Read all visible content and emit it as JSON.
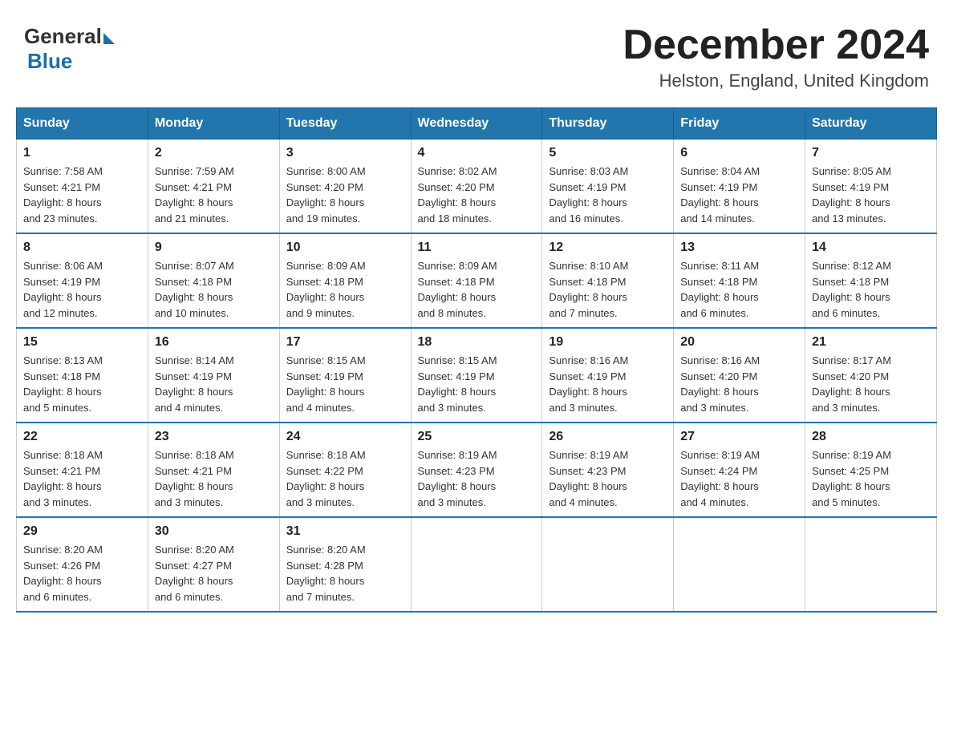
{
  "header": {
    "logo_general": "General",
    "logo_blue": "Blue",
    "month_title": "December 2024",
    "location": "Helston, England, United Kingdom"
  },
  "days_of_week": [
    "Sunday",
    "Monday",
    "Tuesday",
    "Wednesday",
    "Thursday",
    "Friday",
    "Saturday"
  ],
  "weeks": [
    [
      {
        "day": "1",
        "sunrise": "7:58 AM",
        "sunset": "4:21 PM",
        "daylight": "8 hours and 23 minutes."
      },
      {
        "day": "2",
        "sunrise": "7:59 AM",
        "sunset": "4:21 PM",
        "daylight": "8 hours and 21 minutes."
      },
      {
        "day": "3",
        "sunrise": "8:00 AM",
        "sunset": "4:20 PM",
        "daylight": "8 hours and 19 minutes."
      },
      {
        "day": "4",
        "sunrise": "8:02 AM",
        "sunset": "4:20 PM",
        "daylight": "8 hours and 18 minutes."
      },
      {
        "day": "5",
        "sunrise": "8:03 AM",
        "sunset": "4:19 PM",
        "daylight": "8 hours and 16 minutes."
      },
      {
        "day": "6",
        "sunrise": "8:04 AM",
        "sunset": "4:19 PM",
        "daylight": "8 hours and 14 minutes."
      },
      {
        "day": "7",
        "sunrise": "8:05 AM",
        "sunset": "4:19 PM",
        "daylight": "8 hours and 13 minutes."
      }
    ],
    [
      {
        "day": "8",
        "sunrise": "8:06 AM",
        "sunset": "4:19 PM",
        "daylight": "8 hours and 12 minutes."
      },
      {
        "day": "9",
        "sunrise": "8:07 AM",
        "sunset": "4:18 PM",
        "daylight": "8 hours and 10 minutes."
      },
      {
        "day": "10",
        "sunrise": "8:09 AM",
        "sunset": "4:18 PM",
        "daylight": "8 hours and 9 minutes."
      },
      {
        "day": "11",
        "sunrise": "8:09 AM",
        "sunset": "4:18 PM",
        "daylight": "8 hours and 8 minutes."
      },
      {
        "day": "12",
        "sunrise": "8:10 AM",
        "sunset": "4:18 PM",
        "daylight": "8 hours and 7 minutes."
      },
      {
        "day": "13",
        "sunrise": "8:11 AM",
        "sunset": "4:18 PM",
        "daylight": "8 hours and 6 minutes."
      },
      {
        "day": "14",
        "sunrise": "8:12 AM",
        "sunset": "4:18 PM",
        "daylight": "8 hours and 6 minutes."
      }
    ],
    [
      {
        "day": "15",
        "sunrise": "8:13 AM",
        "sunset": "4:18 PM",
        "daylight": "8 hours and 5 minutes."
      },
      {
        "day": "16",
        "sunrise": "8:14 AM",
        "sunset": "4:19 PM",
        "daylight": "8 hours and 4 minutes."
      },
      {
        "day": "17",
        "sunrise": "8:15 AM",
        "sunset": "4:19 PM",
        "daylight": "8 hours and 4 minutes."
      },
      {
        "day": "18",
        "sunrise": "8:15 AM",
        "sunset": "4:19 PM",
        "daylight": "8 hours and 3 minutes."
      },
      {
        "day": "19",
        "sunrise": "8:16 AM",
        "sunset": "4:19 PM",
        "daylight": "8 hours and 3 minutes."
      },
      {
        "day": "20",
        "sunrise": "8:16 AM",
        "sunset": "4:20 PM",
        "daylight": "8 hours and 3 minutes."
      },
      {
        "day": "21",
        "sunrise": "8:17 AM",
        "sunset": "4:20 PM",
        "daylight": "8 hours and 3 minutes."
      }
    ],
    [
      {
        "day": "22",
        "sunrise": "8:18 AM",
        "sunset": "4:21 PM",
        "daylight": "8 hours and 3 minutes."
      },
      {
        "day": "23",
        "sunrise": "8:18 AM",
        "sunset": "4:21 PM",
        "daylight": "8 hours and 3 minutes."
      },
      {
        "day": "24",
        "sunrise": "8:18 AM",
        "sunset": "4:22 PM",
        "daylight": "8 hours and 3 minutes."
      },
      {
        "day": "25",
        "sunrise": "8:19 AM",
        "sunset": "4:23 PM",
        "daylight": "8 hours and 3 minutes."
      },
      {
        "day": "26",
        "sunrise": "8:19 AM",
        "sunset": "4:23 PM",
        "daylight": "8 hours and 4 minutes."
      },
      {
        "day": "27",
        "sunrise": "8:19 AM",
        "sunset": "4:24 PM",
        "daylight": "8 hours and 4 minutes."
      },
      {
        "day": "28",
        "sunrise": "8:19 AM",
        "sunset": "4:25 PM",
        "daylight": "8 hours and 5 minutes."
      }
    ],
    [
      {
        "day": "29",
        "sunrise": "8:20 AM",
        "sunset": "4:26 PM",
        "daylight": "8 hours and 6 minutes."
      },
      {
        "day": "30",
        "sunrise": "8:20 AM",
        "sunset": "4:27 PM",
        "daylight": "8 hours and 6 minutes."
      },
      {
        "day": "31",
        "sunrise": "8:20 AM",
        "sunset": "4:28 PM",
        "daylight": "8 hours and 7 minutes."
      },
      null,
      null,
      null,
      null
    ]
  ],
  "labels": {
    "sunrise": "Sunrise:",
    "sunset": "Sunset:",
    "daylight": "Daylight:"
  }
}
